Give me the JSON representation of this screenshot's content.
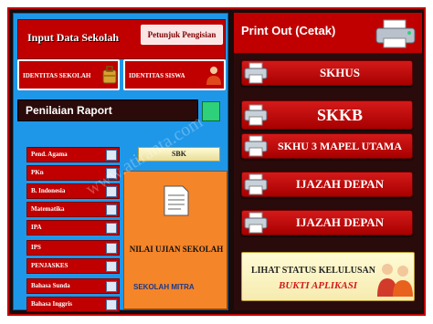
{
  "input": {
    "title": "Input Data Sekolah",
    "petunjuk_label": "Petunjuk Pengisian",
    "identitas_sekolah_label": "IDENTITAS SEKOLAH",
    "identitas_siswa_label": "IDENTITAS SISWA"
  },
  "penilaian": {
    "title": "Penilaian Raport",
    "subjects": [
      "Pend. Agama",
      "PKn",
      "B. Indonesia",
      "Matematika",
      "IPA",
      "IPS",
      "PENJASKES",
      "Bahasa Sunda",
      "Bahasa Inggris"
    ],
    "sbk_label": "SBK",
    "nus_label": "NILAI UJIAN SEKOLAH",
    "sekolah_logo": "SEKOLAH MITRA"
  },
  "print": {
    "title": "Print Out (Cetak)",
    "buttons": [
      "SKHUS",
      "SKKB",
      "SKHU 3 MAPEL UTAMA",
      "IJAZAH DEPAN",
      "IJAZAH DEPAN"
    ],
    "status_title": "LIHAT STATUS KELULUSAN",
    "bukti_label": "BUKTI APLIKASI"
  },
  "watermark": "www.atiranta.com",
  "colors": {
    "red": "#c00000",
    "blue": "#1f97e8",
    "orange": "#f58529",
    "cream": "#fffbd4",
    "green": "#2ed07a"
  }
}
